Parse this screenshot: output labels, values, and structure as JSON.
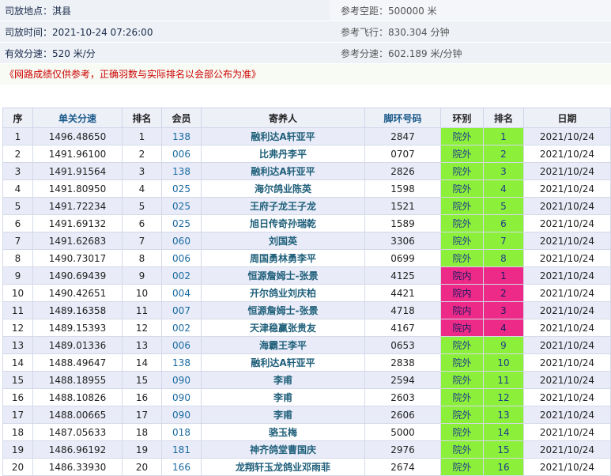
{
  "info": {
    "location": "司放地点：淇县",
    "release_time": "司放时间：2021-10-24 07:26:00",
    "speed": "有效分速：520 米/分",
    "distance": "参考空距：500000 米",
    "flight_time": "参考飞行：830.304 分钟",
    "ref_speed": "参考分速：602.189 米/分钟"
  },
  "notice": "《网路成绩仅供参考，正确羽数与实际排名以会部公布为准》",
  "table": {
    "headers": [
      "序",
      "单关分速",
      "排名",
      "会员",
      "寄养人",
      "脚环号码",
      "环别",
      "排名",
      "日期"
    ],
    "rows": [
      {
        "no": "1",
        "speed": "1496.48650",
        "rank": "1",
        "member": "138",
        "owner": "融利达A轩亚平",
        "ring": "2847",
        "type": "院外",
        "type_code": "out",
        "rank2": "1",
        "date": "2021/10/24"
      },
      {
        "no": "2",
        "speed": "1491.96100",
        "rank": "2",
        "member": "006",
        "owner": "比弗丹李平",
        "ring": "0707",
        "type": "院外",
        "type_code": "out",
        "rank2": "2",
        "date": "2021/10/24"
      },
      {
        "no": "3",
        "speed": "1491.91564",
        "rank": "3",
        "member": "138",
        "owner": "融利达A轩亚平",
        "ring": "2826",
        "type": "院外",
        "type_code": "out",
        "rank2": "3",
        "date": "2021/10/24"
      },
      {
        "no": "4",
        "speed": "1491.80950",
        "rank": "4",
        "member": "025",
        "owner": "海尔鸽业陈英",
        "ring": "1598",
        "type": "院外",
        "type_code": "out",
        "rank2": "4",
        "date": "2021/10/24"
      },
      {
        "no": "5",
        "speed": "1491.72234",
        "rank": "5",
        "member": "025",
        "owner": "王府子龙王子龙",
        "ring": "1521",
        "type": "院外",
        "type_code": "out",
        "rank2": "5",
        "date": "2021/10/24"
      },
      {
        "no": "6",
        "speed": "1491.69132",
        "rank": "6",
        "member": "025",
        "owner": "旭日传奇孙瑞乾",
        "ring": "1589",
        "type": "院外",
        "type_code": "out",
        "rank2": "6",
        "date": "2021/10/24"
      },
      {
        "no": "7",
        "speed": "1491.62683",
        "rank": "7",
        "member": "060",
        "owner": "刘国英",
        "ring": "3306",
        "type": "院外",
        "type_code": "out",
        "rank2": "7",
        "date": "2021/10/24"
      },
      {
        "no": "8",
        "speed": "1490.73017",
        "rank": "8",
        "member": "006",
        "owner": "周国勇林勇李平",
        "ring": "0699",
        "type": "院外",
        "type_code": "out",
        "rank2": "8",
        "date": "2021/10/24"
      },
      {
        "no": "9",
        "speed": "1490.69439",
        "rank": "9",
        "member": "002",
        "owner": "恒源詹姆士-张景",
        "ring": "4125",
        "type": "院内",
        "type_code": "in",
        "rank2": "1",
        "date": "2021/10/24"
      },
      {
        "no": "10",
        "speed": "1490.42651",
        "rank": "10",
        "member": "004",
        "owner": "开尔鸽业刘庆柏",
        "ring": "4421",
        "type": "院内",
        "type_code": "in",
        "rank2": "2",
        "date": "2021/10/24"
      },
      {
        "no": "11",
        "speed": "1489.16358",
        "rank": "11",
        "member": "007",
        "owner": "恒源詹姆士-张景",
        "ring": "4718",
        "type": "院内",
        "type_code": "in",
        "rank2": "3",
        "date": "2021/10/24"
      },
      {
        "no": "12",
        "speed": "1489.15393",
        "rank": "12",
        "member": "002",
        "owner": "天津稳赢张贵友",
        "ring": "4167",
        "type": "院内",
        "type_code": "in",
        "rank2": "4",
        "date": "2021/10/24"
      },
      {
        "no": "13",
        "speed": "1489.01336",
        "rank": "13",
        "member": "006",
        "owner": "海霸王李平",
        "ring": "0653",
        "type": "院外",
        "type_code": "out",
        "rank2": "9",
        "date": "2021/10/24"
      },
      {
        "no": "14",
        "speed": "1488.49647",
        "rank": "14",
        "member": "138",
        "owner": "融利达A轩亚平",
        "ring": "2838",
        "type": "院外",
        "type_code": "out",
        "rank2": "10",
        "date": "2021/10/24"
      },
      {
        "no": "15",
        "speed": "1488.18955",
        "rank": "15",
        "member": "090",
        "owner": "李甫",
        "ring": "2594",
        "type": "院外",
        "type_code": "out",
        "rank2": "11",
        "date": "2021/10/24"
      },
      {
        "no": "16",
        "speed": "1488.10826",
        "rank": "16",
        "member": "090",
        "owner": "李甫",
        "ring": "2603",
        "type": "院外",
        "type_code": "out",
        "rank2": "12",
        "date": "2021/10/24"
      },
      {
        "no": "17",
        "speed": "1488.00665",
        "rank": "17",
        "member": "090",
        "owner": "李甫",
        "ring": "2606",
        "type": "院外",
        "type_code": "out",
        "rank2": "13",
        "date": "2021/10/24"
      },
      {
        "no": "18",
        "speed": "1487.05633",
        "rank": "18",
        "member": "018",
        "owner": "骆玉梅",
        "ring": "5000",
        "type": "院外",
        "type_code": "out",
        "rank2": "14",
        "date": "2021/10/24"
      },
      {
        "no": "19",
        "speed": "1486.96192",
        "rank": "19",
        "member": "181",
        "owner": "神齐鸽堂曹国庆",
        "ring": "2976",
        "type": "院外",
        "type_code": "out",
        "rank2": "15",
        "date": "2021/10/24"
      },
      {
        "no": "20",
        "speed": "1486.33930",
        "rank": "20",
        "member": "166",
        "owner": "龙翔轩玉龙鸽业邓雨菲",
        "ring": "2674",
        "type": "院外",
        "type_code": "out",
        "rank2": "16",
        "date": "2021/10/24"
      }
    ]
  }
}
